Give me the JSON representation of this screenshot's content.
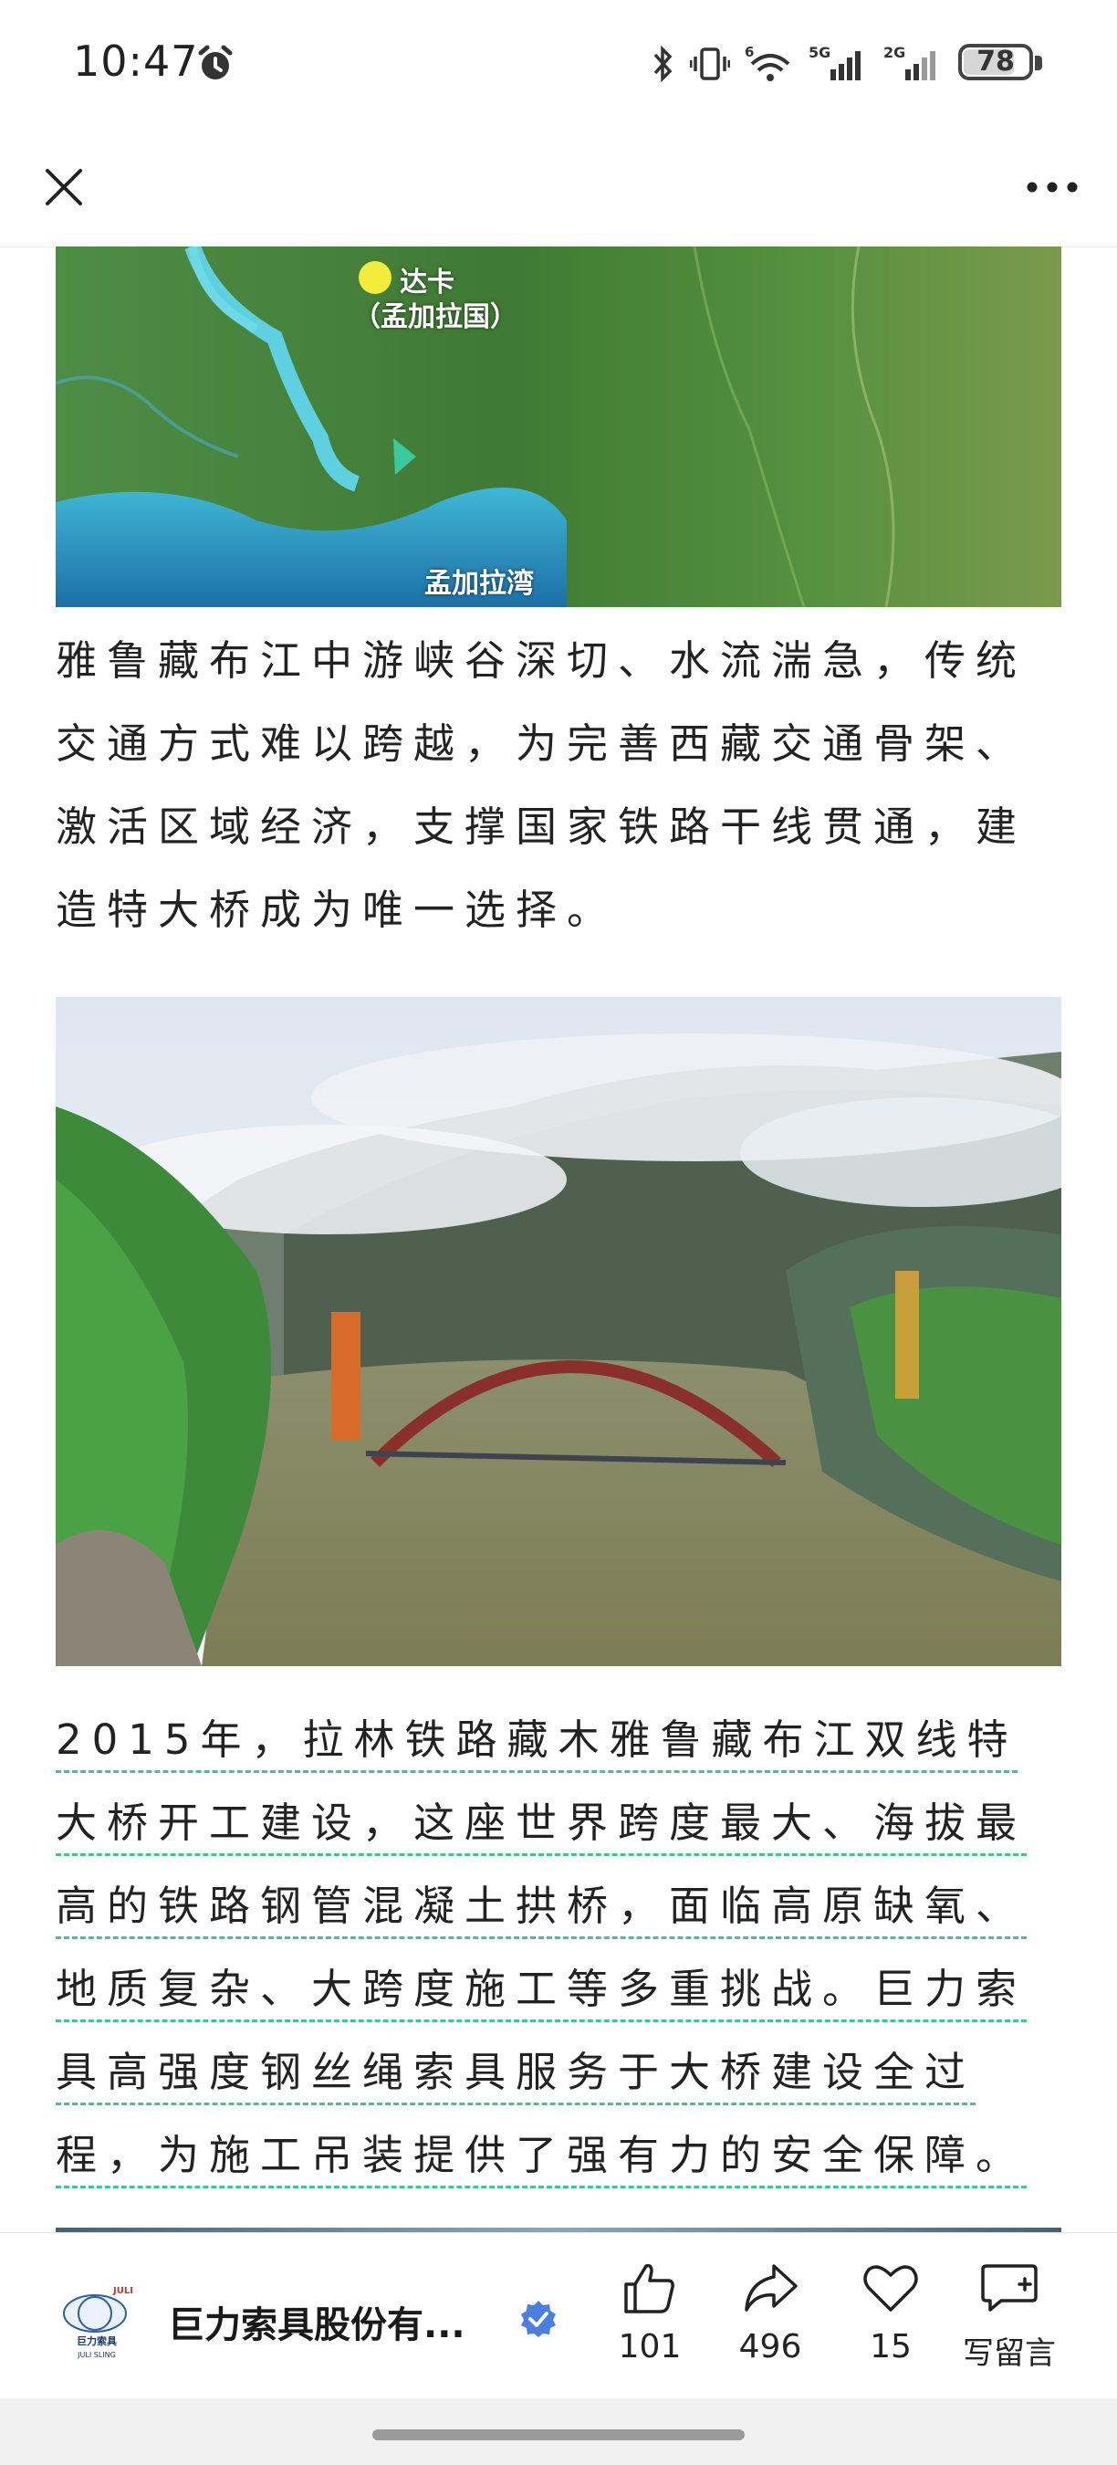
{
  "status_bar": {
    "time": "10:47",
    "battery": "78",
    "battery_level_percent": 78,
    "signal_1": "5G",
    "signal_2": "2G",
    "wifi_badge": "6",
    "icons": [
      "alarm-icon",
      "bluetooth-icon",
      "vibrate-icon",
      "wifi-icon",
      "cellular-signal-icon",
      "battery-icon"
    ]
  },
  "nav": {
    "close_icon": "close-icon",
    "more_icon": "more-icon"
  },
  "article": {
    "map_labels": {
      "dhaka": "达卡",
      "dhaka_country": "（孟加拉国）",
      "bay": "孟加拉湾"
    },
    "paragraph1": "雅鲁藏布江中游峡谷深切、水流湍急，传统交通方式难以跨越，为完善西藏交通骨架、激活区域经济，支撑国家铁路干线贯通，建造特大桥成为唯一选择。",
    "paragraph2": "2015年，拉林铁路藏木雅鲁藏布江双线特大桥开工建设，这座世界跨度最大、海拔最高的铁路钢管混凝土拱桥，面临高原缺氧、地质复杂、大跨度施工等多重挑战。巨力索具高强度钢丝绳索具服务于大桥建设全过程，为施工吊装提供了强有力的安全保障。"
  },
  "bottom_bar": {
    "logo_text_top": "JULI",
    "logo_text_cn": "巨力索具",
    "logo_text_en": "JULI SLING",
    "account_name": "巨力索具股份有...",
    "like_count": "101",
    "share_count": "496",
    "favorite_count": "15",
    "comment_label": "写留言"
  },
  "colors": {
    "underline_accent": "#44c19a",
    "verified_badge": "#4a7fe0"
  }
}
